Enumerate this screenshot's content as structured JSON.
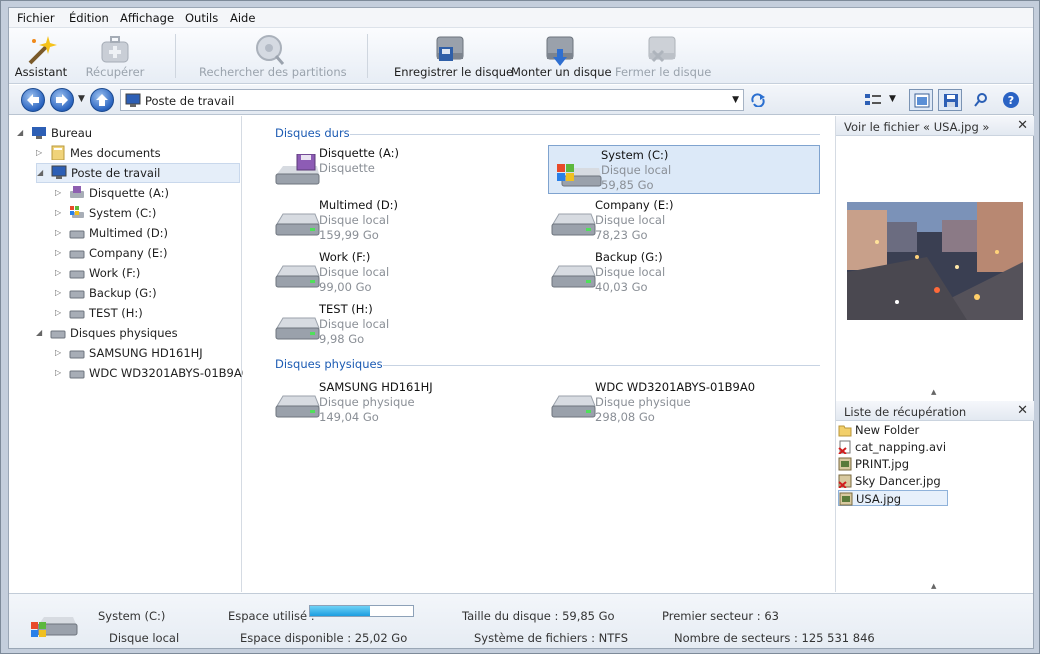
{
  "menu": [
    "Fichier",
    "Édition",
    "Affichage",
    "Outils",
    "Aide"
  ],
  "toolbar": {
    "assistant": "Assistant",
    "recuperer": "Récupérer",
    "rechercher": "Rechercher des partitions",
    "enregistrer": "Enregistrer le disque",
    "monter": "Monter un disque",
    "fermer": "Fermer le disque"
  },
  "address": {
    "text": "Poste de travail"
  },
  "tree": {
    "bureau": "Bureau",
    "mes_documents": "Mes documents",
    "poste": "Poste de travail",
    "drives": [
      "Disquette (A:)",
      "System (C:)",
      "Multimed (D:)",
      "Company (E:)",
      "Work (F:)",
      "Backup (G:)",
      "TEST (H:)"
    ],
    "physiques": "Disques physiques",
    "phys": [
      "SAMSUNG HD161HJ",
      "WDC WD3201ABYS-01B9A0"
    ]
  },
  "center": {
    "group_hard": "Disques durs",
    "group_phys": "Disques physiques",
    "drives": [
      {
        "name": "Disquette (A:)",
        "type": "Disquette",
        "size": ""
      },
      {
        "name": "System (C:)",
        "type": "Disque local",
        "size": "59,85 Go"
      },
      {
        "name": "Multimed (D:)",
        "type": "Disque local",
        "size": "159,99 Go"
      },
      {
        "name": "Company (E:)",
        "type": "Disque local",
        "size": "78,23 Go"
      },
      {
        "name": "Work (F:)",
        "type": "Disque local",
        "size": "99,00 Go"
      },
      {
        "name": "Backup (G:)",
        "type": "Disque local",
        "size": "40,03 Go"
      },
      {
        "name": "TEST (H:)",
        "type": "Disque local",
        "size": "9,98 Go"
      }
    ],
    "physical": [
      {
        "name": "SAMSUNG HD161HJ",
        "type": "Disque physique",
        "size": "149,04 Go"
      },
      {
        "name": "WDC WD3201ABYS-01B9A0",
        "type": "Disque physique",
        "size": "298,08 Go"
      }
    ]
  },
  "preview": {
    "title": "Voir le fichier « USA.jpg »"
  },
  "recovery": {
    "title": "Liste de récupération",
    "items": [
      "New Folder",
      "cat_napping.avi",
      "PRINT.jpg",
      "Sky Dancer.jpg",
      "USA.jpg"
    ]
  },
  "status": {
    "drive_name": "System (C:)",
    "drive_type": "Disque local",
    "used_label": "Espace utilisé :",
    "used_fraction": 0.58,
    "free": "Espace disponible : 25,02 Go",
    "size": "Taille du disque : 59,85 Go",
    "fs": "Système de fichiers : NTFS",
    "first": "Premier secteur : 63",
    "count": "Nombre de secteurs : 125 531 846"
  }
}
